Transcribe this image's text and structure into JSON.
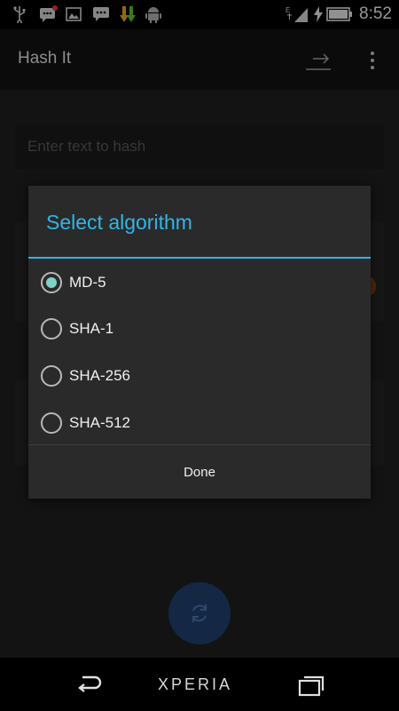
{
  "status_bar": {
    "time": "8:52",
    "left_icons": [
      "usb-icon",
      "messaging-icon",
      "gallery-icon",
      "messaging-icon",
      "download-icon",
      "android-icon"
    ],
    "right_icons": [
      "edge-signal-icon",
      "battery-charging-icon"
    ]
  },
  "app_bar": {
    "title": "Hash It",
    "actions": [
      "share-icon",
      "overflow-menu-icon"
    ]
  },
  "input": {
    "placeholder": "Enter text to hash",
    "value": ""
  },
  "dialog": {
    "title": "Select algorithm",
    "options": [
      {
        "label": "MD-5",
        "selected": true
      },
      {
        "label": "SHA-1",
        "selected": false
      },
      {
        "label": "SHA-256",
        "selected": false
      },
      {
        "label": "SHA-512",
        "selected": false
      }
    ],
    "done_label": "Done"
  },
  "fab": {
    "icon": "refresh-icon"
  },
  "nav_bar": {
    "brand": "XPERIA",
    "buttons": [
      "back-icon",
      "recent-apps-icon"
    ]
  },
  "colors": {
    "accent": "#33b5e5",
    "radio_selected": "#7fd1c8",
    "fab": "#1f3c6b"
  }
}
